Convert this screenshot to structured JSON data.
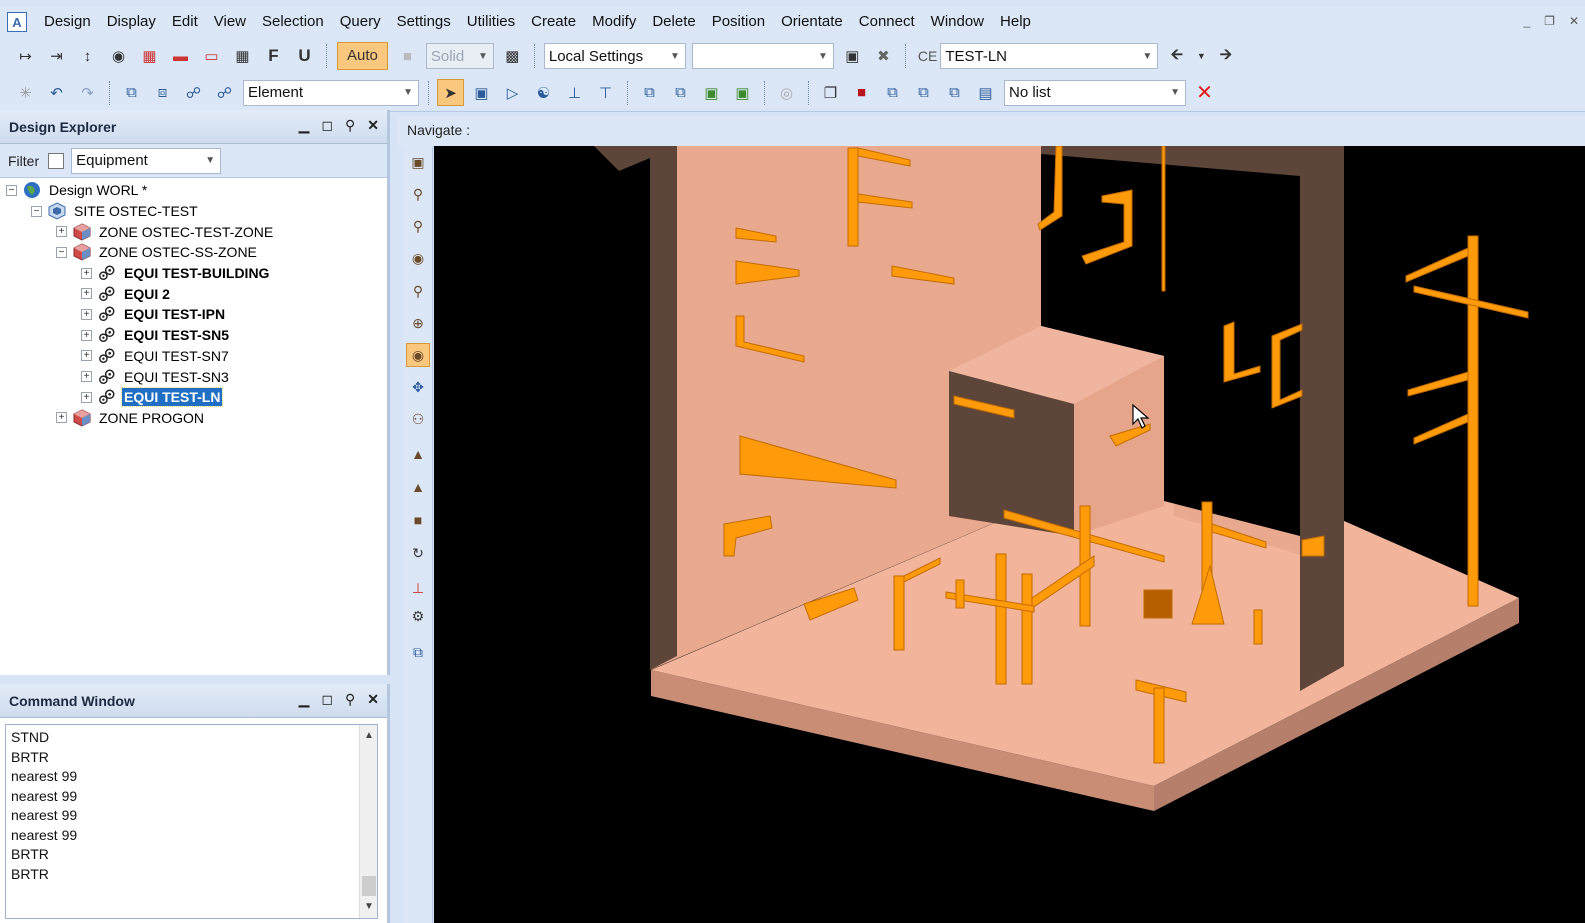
{
  "menu": [
    "Design",
    "Display",
    "Edit",
    "View",
    "Selection",
    "Query",
    "Settings",
    "Utilities",
    "Create",
    "Modify",
    "Delete",
    "Position",
    "Orientate",
    "Connect",
    "Window",
    "Help"
  ],
  "app_logo": "A",
  "toolbar1": {
    "f_button": "F",
    "u_button": "U",
    "auto_button": "Auto",
    "render_mode": "Solid",
    "settings_combo": "Local Settings",
    "empty_combo": "",
    "ce_label": "CE",
    "ce_value": "TEST-LN"
  },
  "toolbar2": {
    "element_combo": "Element",
    "list_combo": "No list"
  },
  "explorer": {
    "title": "Design Explorer",
    "filter_label": "Filter",
    "filter_value": "Equipment",
    "tree": [
      {
        "label": "Design WORL *",
        "icon": "globe-icon",
        "level": 0,
        "expander": "−",
        "style": "normal"
      },
      {
        "label": "SITE OSTEC-TEST",
        "icon": "site-icon",
        "level": 1,
        "expander": "−",
        "style": "normal"
      },
      {
        "label": "ZONE OSTEC-TEST-ZONE",
        "icon": "zone-icon",
        "level": 2,
        "expander": "+",
        "style": "normal"
      },
      {
        "label": "ZONE OSTEC-SS-ZONE",
        "icon": "zone-icon",
        "level": 2,
        "expander": "−",
        "style": "normal"
      },
      {
        "label": "EQUI TEST-BUILDING",
        "icon": "equipment-icon",
        "level": 3,
        "expander": "+",
        "style": "bold"
      },
      {
        "label": "EQUI 2",
        "icon": "equipment-icon",
        "level": 3,
        "expander": "+",
        "style": "bold"
      },
      {
        "label": "EQUI TEST-IPN",
        "icon": "equipment-icon",
        "level": 3,
        "expander": "+",
        "style": "bold"
      },
      {
        "label": "EQUI TEST-SN5",
        "icon": "equipment-icon",
        "level": 3,
        "expander": "+",
        "style": "bold"
      },
      {
        "label": "EQUI TEST-SN7",
        "icon": "equipment-icon",
        "level": 3,
        "expander": "+",
        "style": "normal"
      },
      {
        "label": "EQUI TEST-SN3",
        "icon": "equipment-icon",
        "level": 3,
        "expander": "+",
        "style": "normal"
      },
      {
        "label": "EQUI TEST-LN",
        "icon": "equipment-icon",
        "level": 3,
        "expander": "+",
        "style": "selected"
      },
      {
        "label": "ZONE PROGON",
        "icon": "zone-icon",
        "level": 2,
        "expander": "+",
        "style": "normal"
      }
    ]
  },
  "command_window": {
    "title": "Command Window",
    "lines": [
      "STND",
      "BRTR",
      "nearest 99",
      "nearest 99",
      "nearest 99",
      "nearest 99",
      "BRTR",
      "BRTR"
    ]
  },
  "viewer": {
    "label": "Navigate :"
  },
  "colors": {
    "chrome": "#dbe7f6",
    "selection": "#1f6fc4",
    "floor": "#f2b49a",
    "wall_light": "#e8a98f",
    "wall_dark": "#5e4539",
    "steel": "#ff9a0a"
  }
}
